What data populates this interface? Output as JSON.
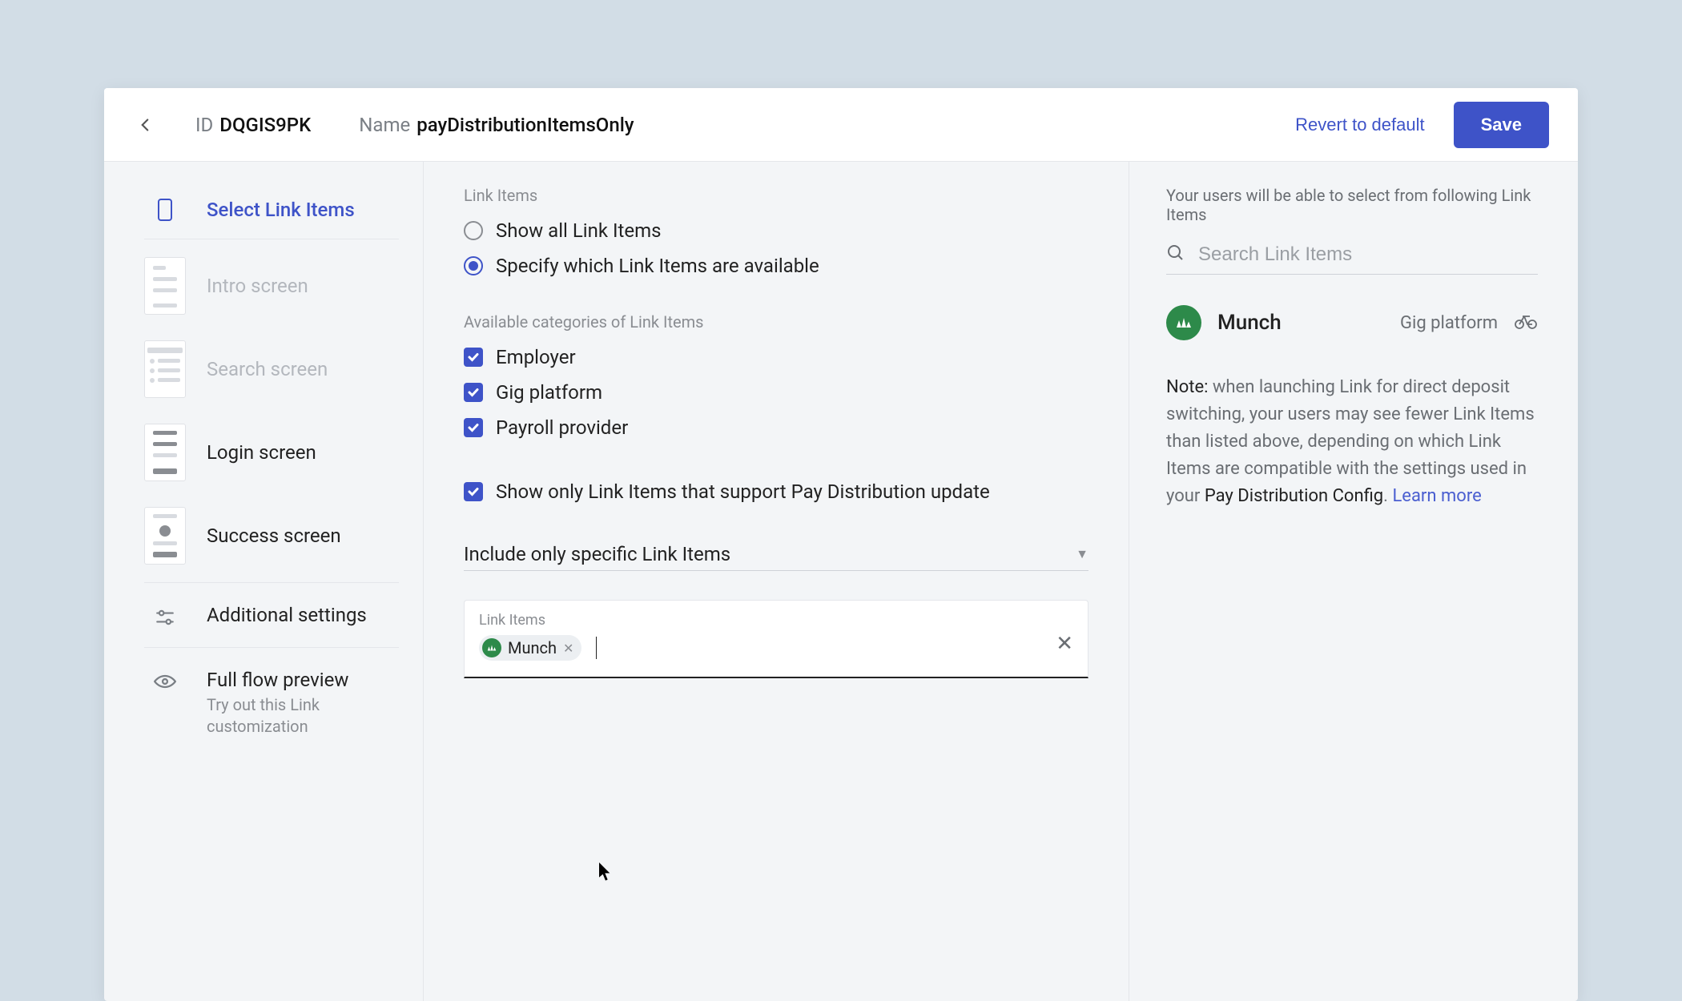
{
  "header": {
    "id_label": "ID",
    "id_value": "DQGIS9PK",
    "name_label": "Name",
    "name_value": "payDistributionItemsOnly",
    "revert": "Revert to default",
    "save": "Save"
  },
  "sidebar": {
    "active": "Select Link Items",
    "screens": [
      "Intro screen",
      "Search screen",
      "Login screen",
      "Success screen"
    ],
    "additional": "Additional settings",
    "preview": "Full flow preview",
    "preview_sub": "Try out this Link customization"
  },
  "mid": {
    "link_items_label": "Link Items",
    "radios": [
      {
        "label": "Show all Link Items",
        "selected": false
      },
      {
        "label": "Specify which Link Items are available",
        "selected": true
      }
    ],
    "categories_label": "Available categories of Link Items",
    "categories": [
      {
        "label": "Employer",
        "checked": true
      },
      {
        "label": "Gig platform",
        "checked": true
      },
      {
        "label": "Payroll provider",
        "checked": true
      }
    ],
    "support_check": "Show only Link Items that support Pay Distribution update",
    "include_select": "Include only specific Link Items",
    "chips_label": "Link Items",
    "chips": [
      {
        "name": "Munch"
      }
    ]
  },
  "right": {
    "intro": "Your users will be able to select from following Link Items",
    "search_placeholder": "Search Link Items",
    "company": {
      "name": "Munch",
      "tag": "Gig platform"
    },
    "note_bold": "Note:",
    "note_body": " when launching Link for direct deposit switching, your users may see fewer Link Items than listed above, depending on which Link Items are compatible with the settings used in your ",
    "note_config": "Pay Distribution Config",
    "note_learn": "Learn more"
  }
}
